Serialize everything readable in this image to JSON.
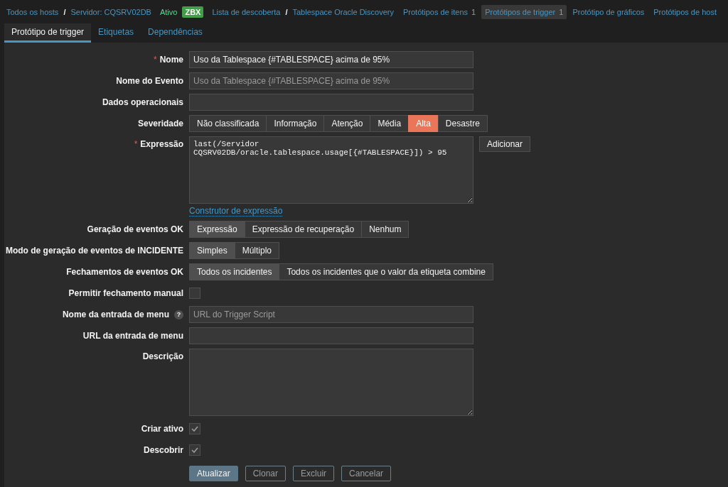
{
  "nav": [
    {
      "kind": "link",
      "text": "Todos os hosts"
    },
    {
      "kind": "separator",
      "text": "/"
    },
    {
      "kind": "link",
      "text": "Servidor: CQSRV02DB"
    },
    {
      "kind": "status",
      "text": "Ativo"
    },
    {
      "kind": "badge",
      "text": "ZBX"
    },
    {
      "kind": "link",
      "text": "Lista de descoberta"
    },
    {
      "kind": "separator",
      "text": "/"
    },
    {
      "kind": "link",
      "text": "Tablespace Oracle Discovery"
    },
    {
      "kind": "tab",
      "text": "Protótipos de itens",
      "count": "1",
      "selected": false
    },
    {
      "kind": "tab",
      "text": "Protótipos de trigger",
      "count": "1",
      "selected": true
    },
    {
      "kind": "tab",
      "text": "Protótipo de gráficos",
      "selected": false
    },
    {
      "kind": "tab",
      "text": "Protótipos de host",
      "selected": false
    }
  ],
  "tabs": [
    {
      "label": "Protótipo de trigger",
      "selected": true
    },
    {
      "label": "Etiquetas",
      "selected": false
    },
    {
      "label": "Dependências",
      "selected": false
    }
  ],
  "fields": [
    {
      "kind": "text",
      "label": "Nome",
      "required_mark": "*",
      "value": "Uso da Tablespace {#TABLESPACE} acima de 95%"
    },
    {
      "kind": "text",
      "label": "Nome do Evento",
      "placeholder": "Uso da Tablespace {#TABLESPACE} acima de 95%"
    },
    {
      "kind": "text",
      "label": "Dados operacionais"
    },
    {
      "kind": "severity",
      "label": "Severidade",
      "options": [
        {
          "label": "Não classificada",
          "selected": false
        },
        {
          "label": "Informação",
          "selected": false
        },
        {
          "label": "Atenção",
          "selected": false
        },
        {
          "label": "Média",
          "selected": false
        },
        {
          "label": "Alta",
          "selected": true
        },
        {
          "label": "Desastre",
          "selected": false
        }
      ]
    },
    {
      "kind": "expression",
      "label": "Expressão",
      "required_mark": "*",
      "value": "last(/Servidor CQSRV02DB/oracle.tablespace.usage[{#TABLESPACE}]) > 95",
      "button": "Adicionar",
      "link": "Construtor de expressão"
    },
    {
      "kind": "segmented",
      "label": "Geração de eventos OK",
      "options": [
        {
          "label": "Expressão",
          "selected": true
        },
        {
          "label": "Expressão de recuperação",
          "selected": false
        },
        {
          "label": "Nenhum",
          "selected": false
        }
      ]
    },
    {
      "kind": "segmented",
      "label": "Modo de geração de eventos de INCIDENTE",
      "options": [
        {
          "label": "Simples",
          "selected": true
        },
        {
          "label": "Múltiplo",
          "selected": false
        }
      ]
    },
    {
      "kind": "segmented",
      "label": "Fechamentos de eventos OK",
      "options": [
        {
          "label": "Todos os incidentes",
          "selected": true
        },
        {
          "label": "Todos os incidentes que o valor da etiqueta combine",
          "selected": false
        }
      ]
    },
    {
      "kind": "checkbox",
      "label": "Permitir fechamento manual",
      "checked": false
    },
    {
      "kind": "text",
      "label": "Nome da entrada de menu",
      "help": "?",
      "placeholder": "URL do Trigger Script"
    },
    {
      "kind": "text",
      "label": "URL da entrada de menu"
    },
    {
      "kind": "textarea",
      "label": "Descrição"
    },
    {
      "kind": "checkbox",
      "label": "Criar ativo",
      "checked": true
    },
    {
      "kind": "checkbox",
      "label": "Descobrir",
      "checked": true
    }
  ],
  "buttons": [
    {
      "kind": "primary",
      "label": "Atualizar"
    },
    {
      "kind": "secondary",
      "label": "Clonar"
    },
    {
      "kind": "secondary",
      "label": "Excluir"
    },
    {
      "kind": "secondary",
      "label": "Cancelar"
    }
  ]
}
